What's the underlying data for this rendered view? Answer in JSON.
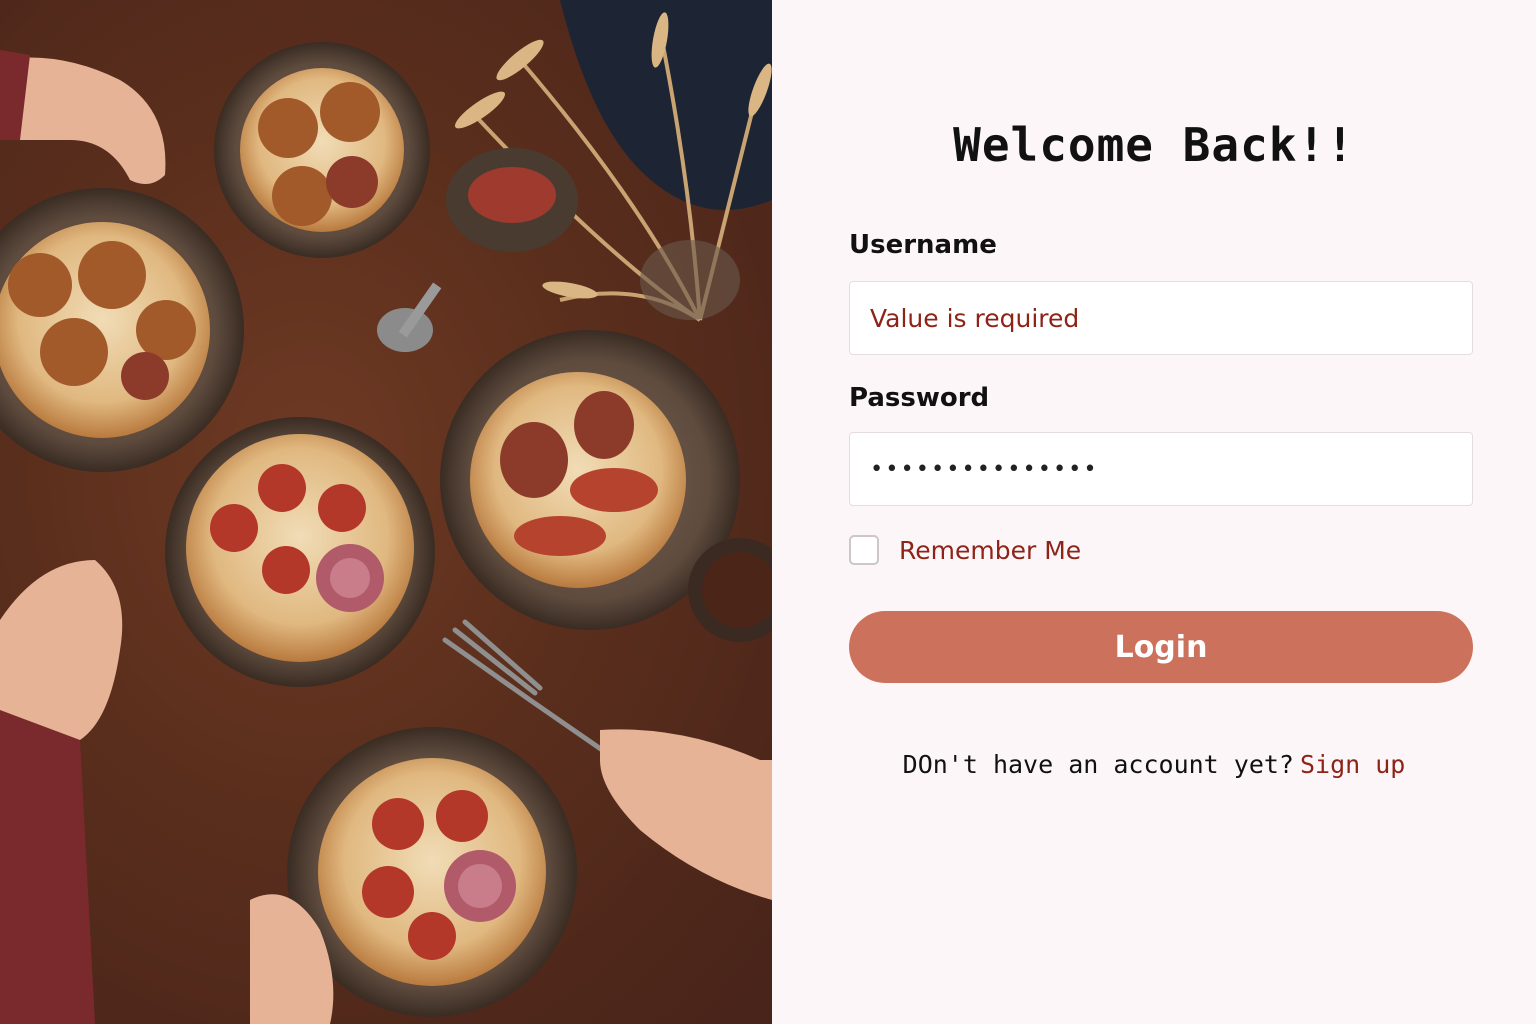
{
  "hero": {
    "image_name": "pizzas-on-table-photo"
  },
  "form": {
    "title": "Welcome Back!!",
    "username": {
      "label": "Username",
      "value": "Value is required"
    },
    "password": {
      "label": "Password",
      "value": "•••••••••••••••"
    },
    "remember_label": "Remember Me",
    "remember_checked": false,
    "login_label": "Login",
    "signup_prompt": "DOn't have an account yet?",
    "signup_link": "Sign up"
  },
  "colors": {
    "accent": "#cc725c",
    "error_text": "#8e2318",
    "panel_bg": "#fdf6f8",
    "table_bg": "#5a2e1c"
  }
}
